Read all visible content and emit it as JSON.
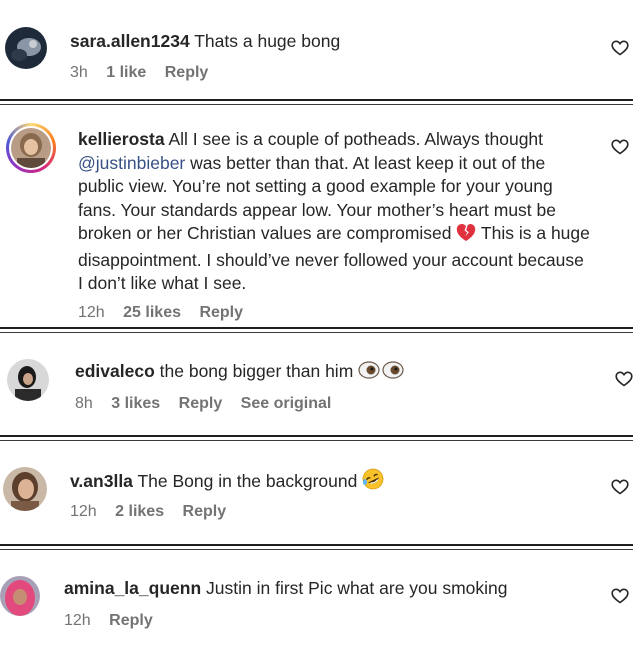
{
  "comments": [
    {
      "username": "sara.allen1234",
      "body": "Thats a huge bong",
      "time": "3h",
      "likes": "1 like",
      "reply": "Reply"
    },
    {
      "username": "kellierosta",
      "body_1": "All I see is a couple of potheads. Always thought",
      "mention": "@justinbieber",
      "body_2": "was better than that. At least keep it out of the public view. You’re not setting a good example for your young fans. Your standards appear low. Your mother’s heart must be broken or her Christian values are compromised",
      "body_3": "This is a huge disappointment. I should’ve never followed your account because I don’t like what I see.",
      "emoji": "broken-heart-emoji",
      "time": "12h",
      "likes": "25 likes",
      "reply": "Reply"
    },
    {
      "username": "edivaleco",
      "body": "the bong bigger than him",
      "emoji": "eyes-emoji",
      "time": "8h",
      "likes": "3 likes",
      "reply": "Reply",
      "see_original": "See original"
    },
    {
      "username": "v.an3lla",
      "body": "The Bong in the background",
      "emoji": "rofl-emoji",
      "time": "12h",
      "likes": "2 likes",
      "reply": "Reply"
    },
    {
      "username": "amina_la_quenn",
      "body": "Justin in first Pic what are you smoking",
      "time": "12h",
      "reply": "Reply"
    }
  ],
  "colors": {
    "text": "#262626",
    "meta": "#737373",
    "mention": "#385185",
    "separator": "#1f1f1f",
    "broken_heart": "#e0313f"
  }
}
